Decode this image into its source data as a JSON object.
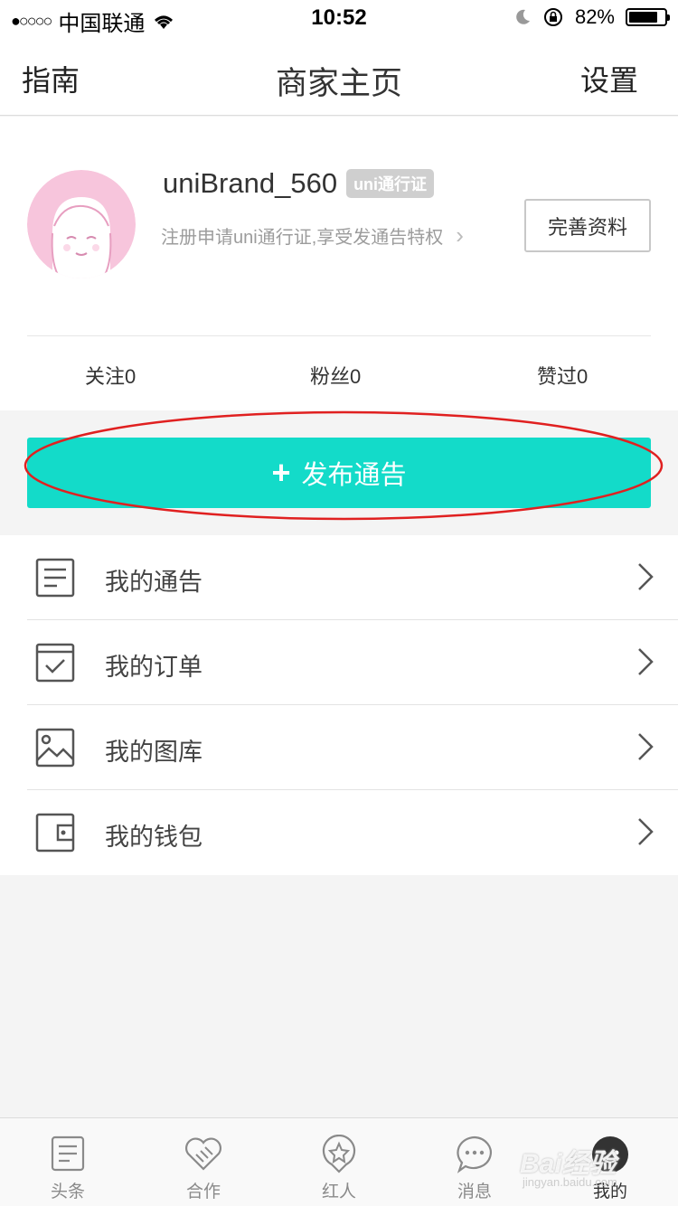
{
  "status_bar": {
    "signal": "●○○○○",
    "carrier": "中国联通",
    "time": "10:52",
    "battery": "82%",
    "battery_level": 0.82
  },
  "nav": {
    "left": "指南",
    "title": "商家主页",
    "right": "设置"
  },
  "profile": {
    "username": "uniBrand_560",
    "badge": "uni通行证",
    "register_tip": "注册申请uni通行证,享受发通告特权",
    "complete_button": "完善资料",
    "stats": {
      "follow": "关注0",
      "fans": "粉丝0",
      "liked": "赞过0"
    }
  },
  "publish": {
    "label": "发布通告",
    "color": "#13dbc9"
  },
  "menu": [
    {
      "label": "我的通告",
      "icon": "document-icon"
    },
    {
      "label": "我的订单",
      "icon": "order-check-icon"
    },
    {
      "label": "我的图库",
      "icon": "image-icon"
    },
    {
      "label": "我的钱包",
      "icon": "wallet-icon"
    }
  ],
  "tabs": [
    {
      "label": "头条",
      "icon": "news-icon"
    },
    {
      "label": "合作",
      "icon": "handshake-icon"
    },
    {
      "label": "红人",
      "icon": "star-badge-icon"
    },
    {
      "label": "消息",
      "icon": "chat-bubble-icon"
    },
    {
      "label": "我的",
      "icon": "profile-face-icon"
    }
  ],
  "watermark": {
    "text": "Bai经验",
    "sub": "jingyan.baidu.com"
  }
}
